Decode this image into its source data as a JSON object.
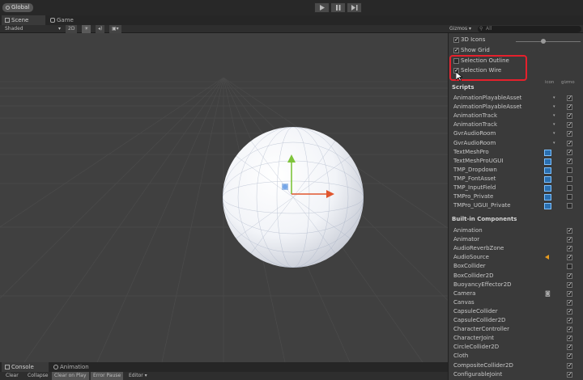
{
  "toolbar": {
    "global_label": "Global"
  },
  "tabs": {
    "scene": "Scene",
    "game": "Game"
  },
  "scene_toolbar": {
    "shading": "Shaded",
    "mode_2d": "2D",
    "gizmos_label": "Gizmos",
    "gizmos_arrow": "▾",
    "search_placeholder": "All"
  },
  "gizmo_panel": {
    "options": [
      {
        "label": "3D Icons",
        "checked": true
      },
      {
        "label": "Show Grid",
        "checked": true
      },
      {
        "label": "Selection Outline",
        "checked": false
      },
      {
        "label": "Selection Wire",
        "checked": true
      }
    ],
    "scripts_title": "Scripts",
    "col_icon": "icon",
    "col_gizmo": "gizmo",
    "scripts": [
      {
        "name": "AnimationPlayableAsset",
        "checked": true
      },
      {
        "name": "AnimationPlayableAsset",
        "checked": true
      },
      {
        "name": "AnimationTrack",
        "checked": true
      },
      {
        "name": "AnimationTrack",
        "checked": true
      },
      {
        "name": "GvrAudioRoom",
        "checked": true
      },
      {
        "name": "GvrAudioRoom",
        "checked": true
      },
      {
        "name": "TextMeshPro",
        "checked": true
      },
      {
        "name": "TextMeshProUGUI",
        "checked": true
      },
      {
        "name": "TMP_Dropdown",
        "checked": false
      },
      {
        "name": "TMP_FontAsset",
        "checked": false
      },
      {
        "name": "TMP_InputField",
        "checked": false
      },
      {
        "name": "TMPro_Private",
        "checked": false
      },
      {
        "name": "TMPro_UGUI_Private",
        "checked": false
      }
    ],
    "builtin_title": "Built-in Components",
    "builtin": [
      {
        "name": "Animation",
        "checked": true
      },
      {
        "name": "Animator",
        "checked": true
      },
      {
        "name": "AudioReverbZone",
        "checked": true
      },
      {
        "name": "AudioSource",
        "checked": true
      },
      {
        "name": "BoxCollider",
        "checked": false
      },
      {
        "name": "BoxCollider2D",
        "checked": true
      },
      {
        "name": "BuoyancyEffector2D",
        "checked": true
      },
      {
        "name": "Camera",
        "checked": true
      },
      {
        "name": "Canvas",
        "checked": true
      },
      {
        "name": "CapsuleCollider",
        "checked": true
      },
      {
        "name": "CapsuleCollider2D",
        "checked": true
      },
      {
        "name": "CharacterController",
        "checked": true
      },
      {
        "name": "CharacterJoint",
        "checked": true
      },
      {
        "name": "CircleCollider2D",
        "checked": true
      },
      {
        "name": "Cloth",
        "checked": true
      },
      {
        "name": "CompositeCollider2D",
        "checked": true
      },
      {
        "name": "ConfigurableJoint",
        "checked": true
      }
    ]
  },
  "bottom": {
    "tab_console": "Console",
    "tab_animation": "Animation",
    "buttons": [
      "Clear",
      "Collapse",
      "Clear on Play",
      "Error Pause",
      "Editor ▾"
    ]
  },
  "colors": {
    "highlight": "#e5202c",
    "accent_blue": "#2a6fb0",
    "audio_icon": "#e79b1f"
  }
}
